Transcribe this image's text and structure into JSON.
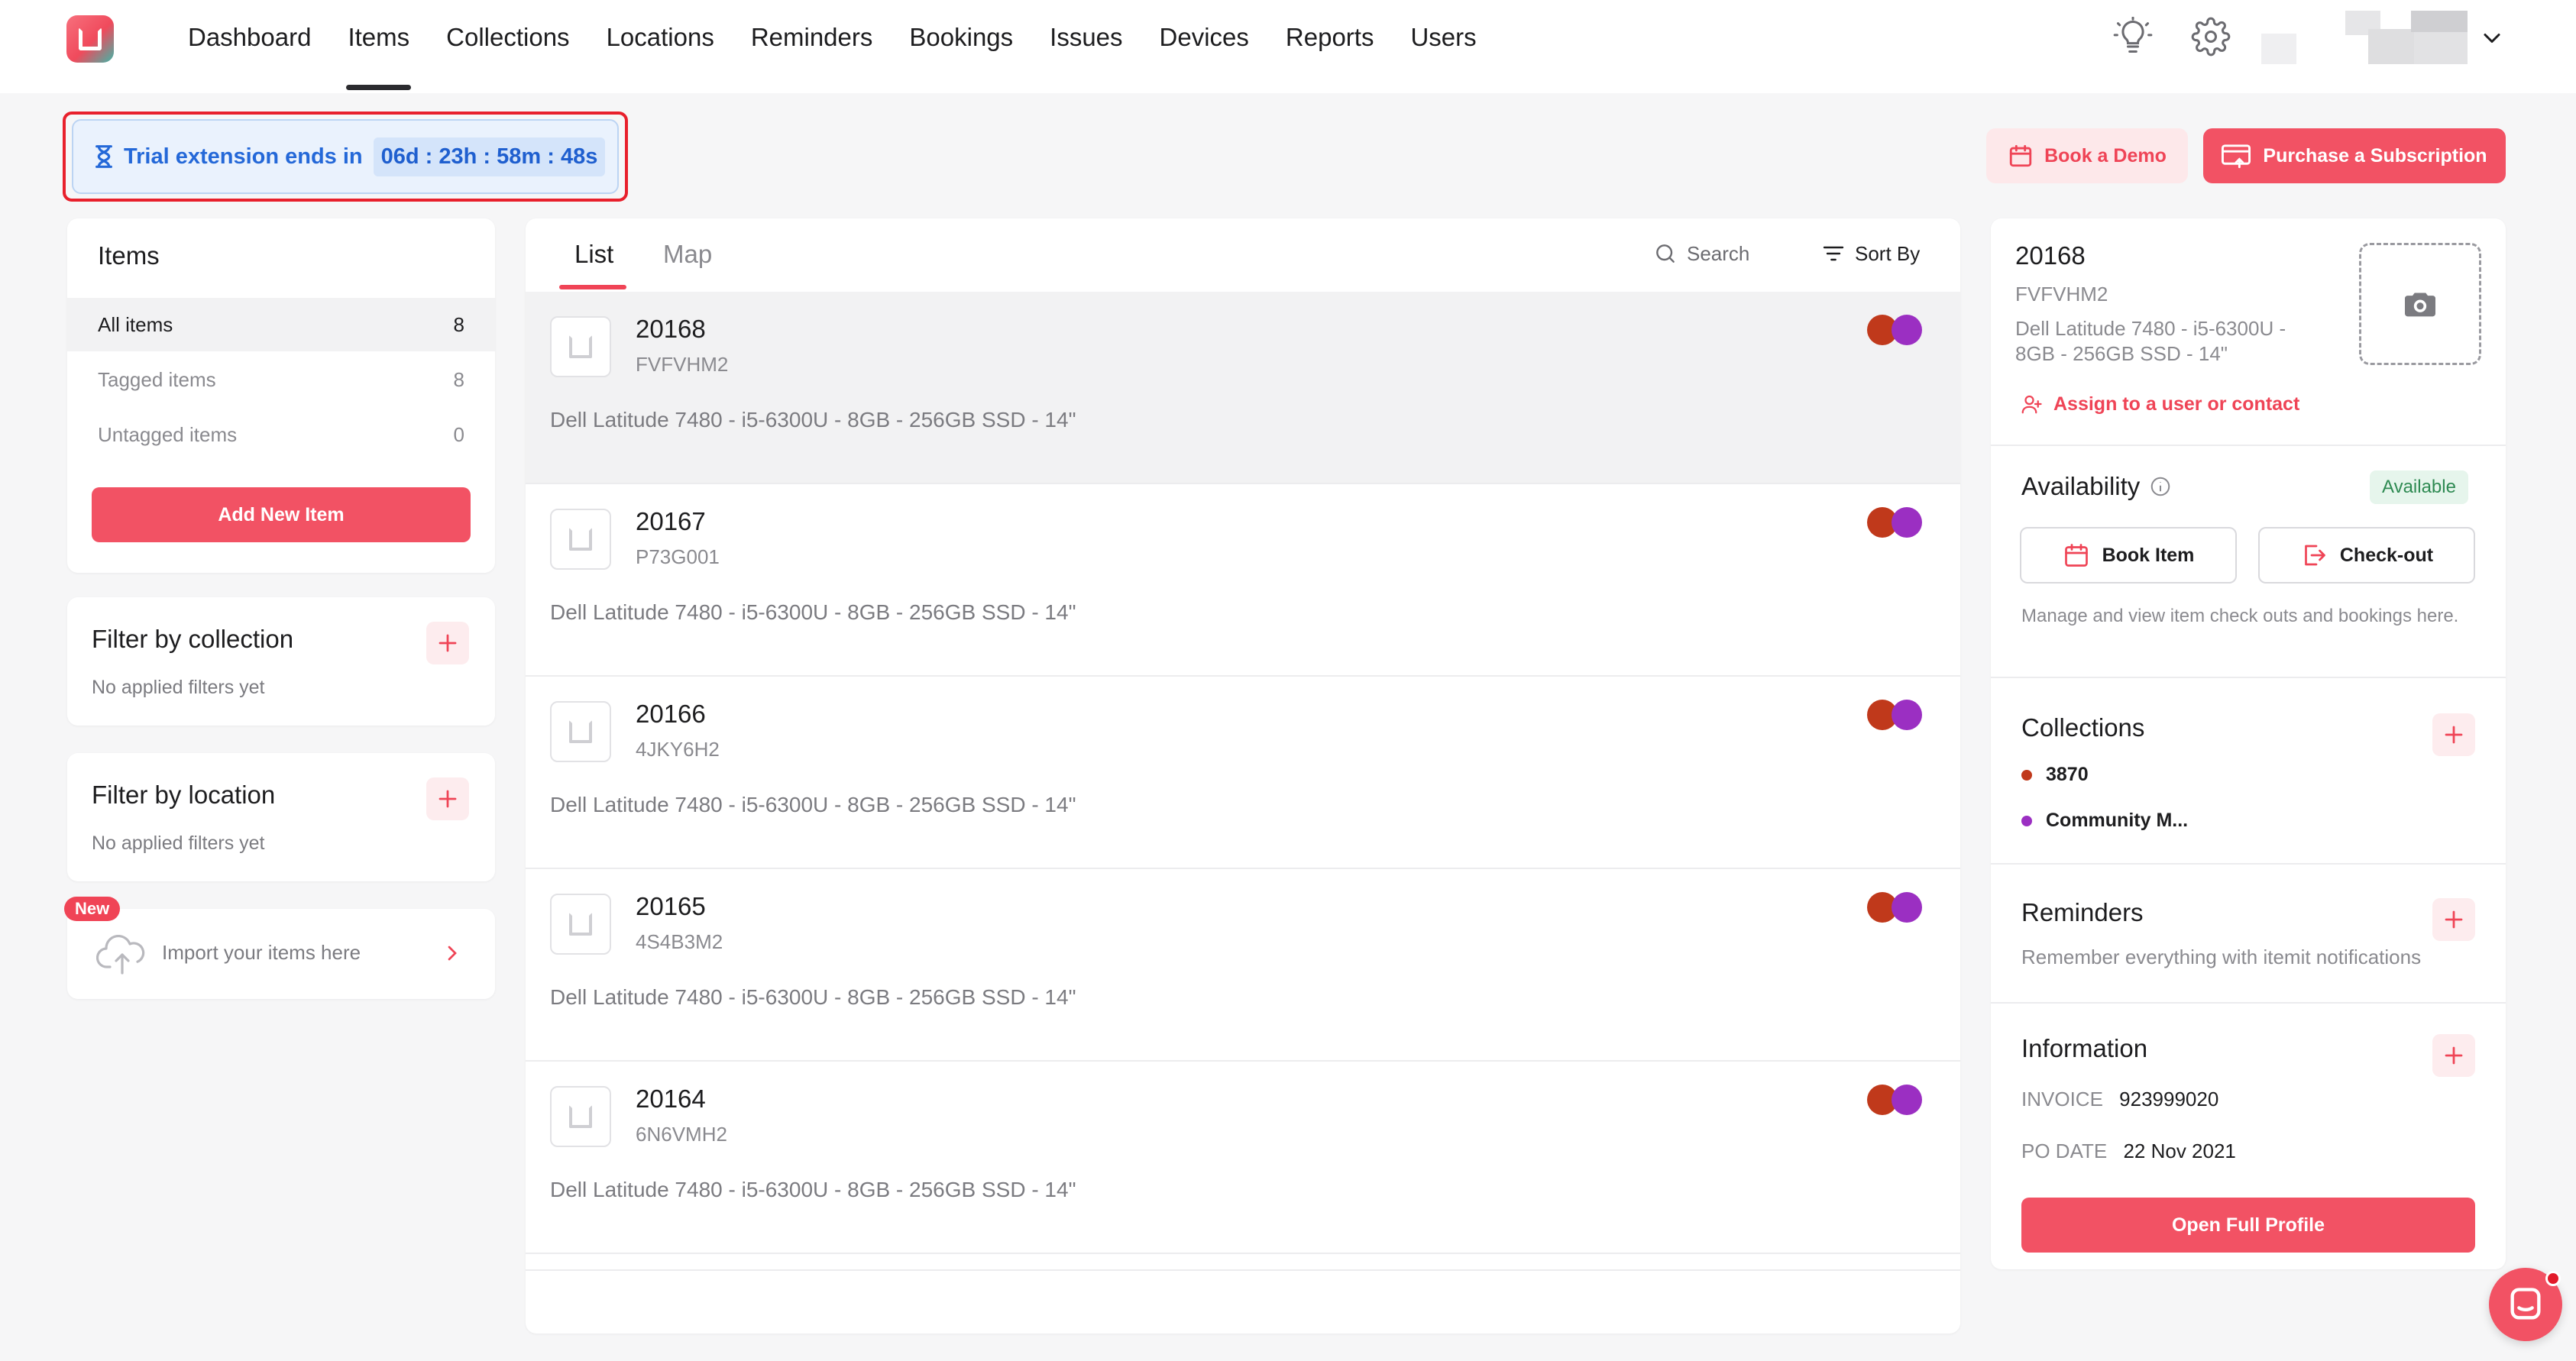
{
  "nav": {
    "items": [
      "Dashboard",
      "Items",
      "Collections",
      "Locations",
      "Reminders",
      "Bookings",
      "Issues",
      "Devices",
      "Reports",
      "Users"
    ],
    "active": "Items"
  },
  "trial": {
    "label": "Trial extension ends in",
    "countdown": "06d : 23h : 58m : 48s"
  },
  "actions": {
    "book_demo": "Book a Demo",
    "purchase": "Purchase a Subscription"
  },
  "sidebar": {
    "title": "Items",
    "rows": [
      {
        "label": "All items",
        "count": "8"
      },
      {
        "label": "Tagged items",
        "count": "8"
      },
      {
        "label": "Untagged items",
        "count": "0"
      }
    ],
    "add_button": "Add New Item",
    "filter_collection": {
      "title": "Filter by collection",
      "sub": "No applied filters yet"
    },
    "filter_location": {
      "title": "Filter by location",
      "sub": "No applied filters yet"
    },
    "import": {
      "badge": "New",
      "label": "Import your items here"
    }
  },
  "list": {
    "tabs": [
      "List",
      "Map"
    ],
    "search_label": "Search",
    "sort_label": "Sort By",
    "items": [
      {
        "id": "20168",
        "serial": "FVFVHM2",
        "desc": "Dell Latitude 7480 - i5-6300U - 8GB - 256GB SSD - 14\""
      },
      {
        "id": "20167",
        "serial": "P73G001",
        "desc": "Dell Latitude 7480 - i5-6300U - 8GB - 256GB SSD - 14\""
      },
      {
        "id": "20166",
        "serial": "4JKY6H2",
        "desc": "Dell Latitude 7480 - i5-6300U - 8GB - 256GB SSD - 14\""
      },
      {
        "id": "20165",
        "serial": "4S4B3M2",
        "desc": "Dell Latitude 7480 - i5-6300U - 8GB - 256GB SSD - 14\""
      },
      {
        "id": "20164",
        "serial": "6N6VMH2",
        "desc": "Dell Latitude 7480 - i5-6300U - 8GB - 256GB SSD - 14\""
      }
    ]
  },
  "detail": {
    "id": "20168",
    "serial": "FVFVHM2",
    "desc": "Dell Latitude 7480 - i5-6300U - 8GB - 256GB SSD - 14\"",
    "assign": "Assign to a user or contact",
    "availability": {
      "title": "Availability",
      "status": "Available"
    },
    "book_item": "Book Item",
    "checkout": "Check-out",
    "manage_text": "Manage and view item check outs and bookings here.",
    "collections": {
      "title": "Collections",
      "items": [
        {
          "name": "3870",
          "color": "#c0391b"
        },
        {
          "name": "Community M...",
          "color": "#9b2fc2"
        }
      ]
    },
    "reminders": {
      "title": "Reminders",
      "text": "Remember everything with itemit notifications"
    },
    "information": {
      "title": "Information",
      "rows": [
        {
          "label": "INVOICE",
          "value": "923999020"
        },
        {
          "label": "PO DATE",
          "value": "22 Nov 2021"
        }
      ]
    },
    "open_profile": "Open Full Profile"
  },
  "colors": {
    "accent": "#f25264",
    "collection_red": "#c0391b",
    "collection_purple": "#9b2fc2"
  }
}
